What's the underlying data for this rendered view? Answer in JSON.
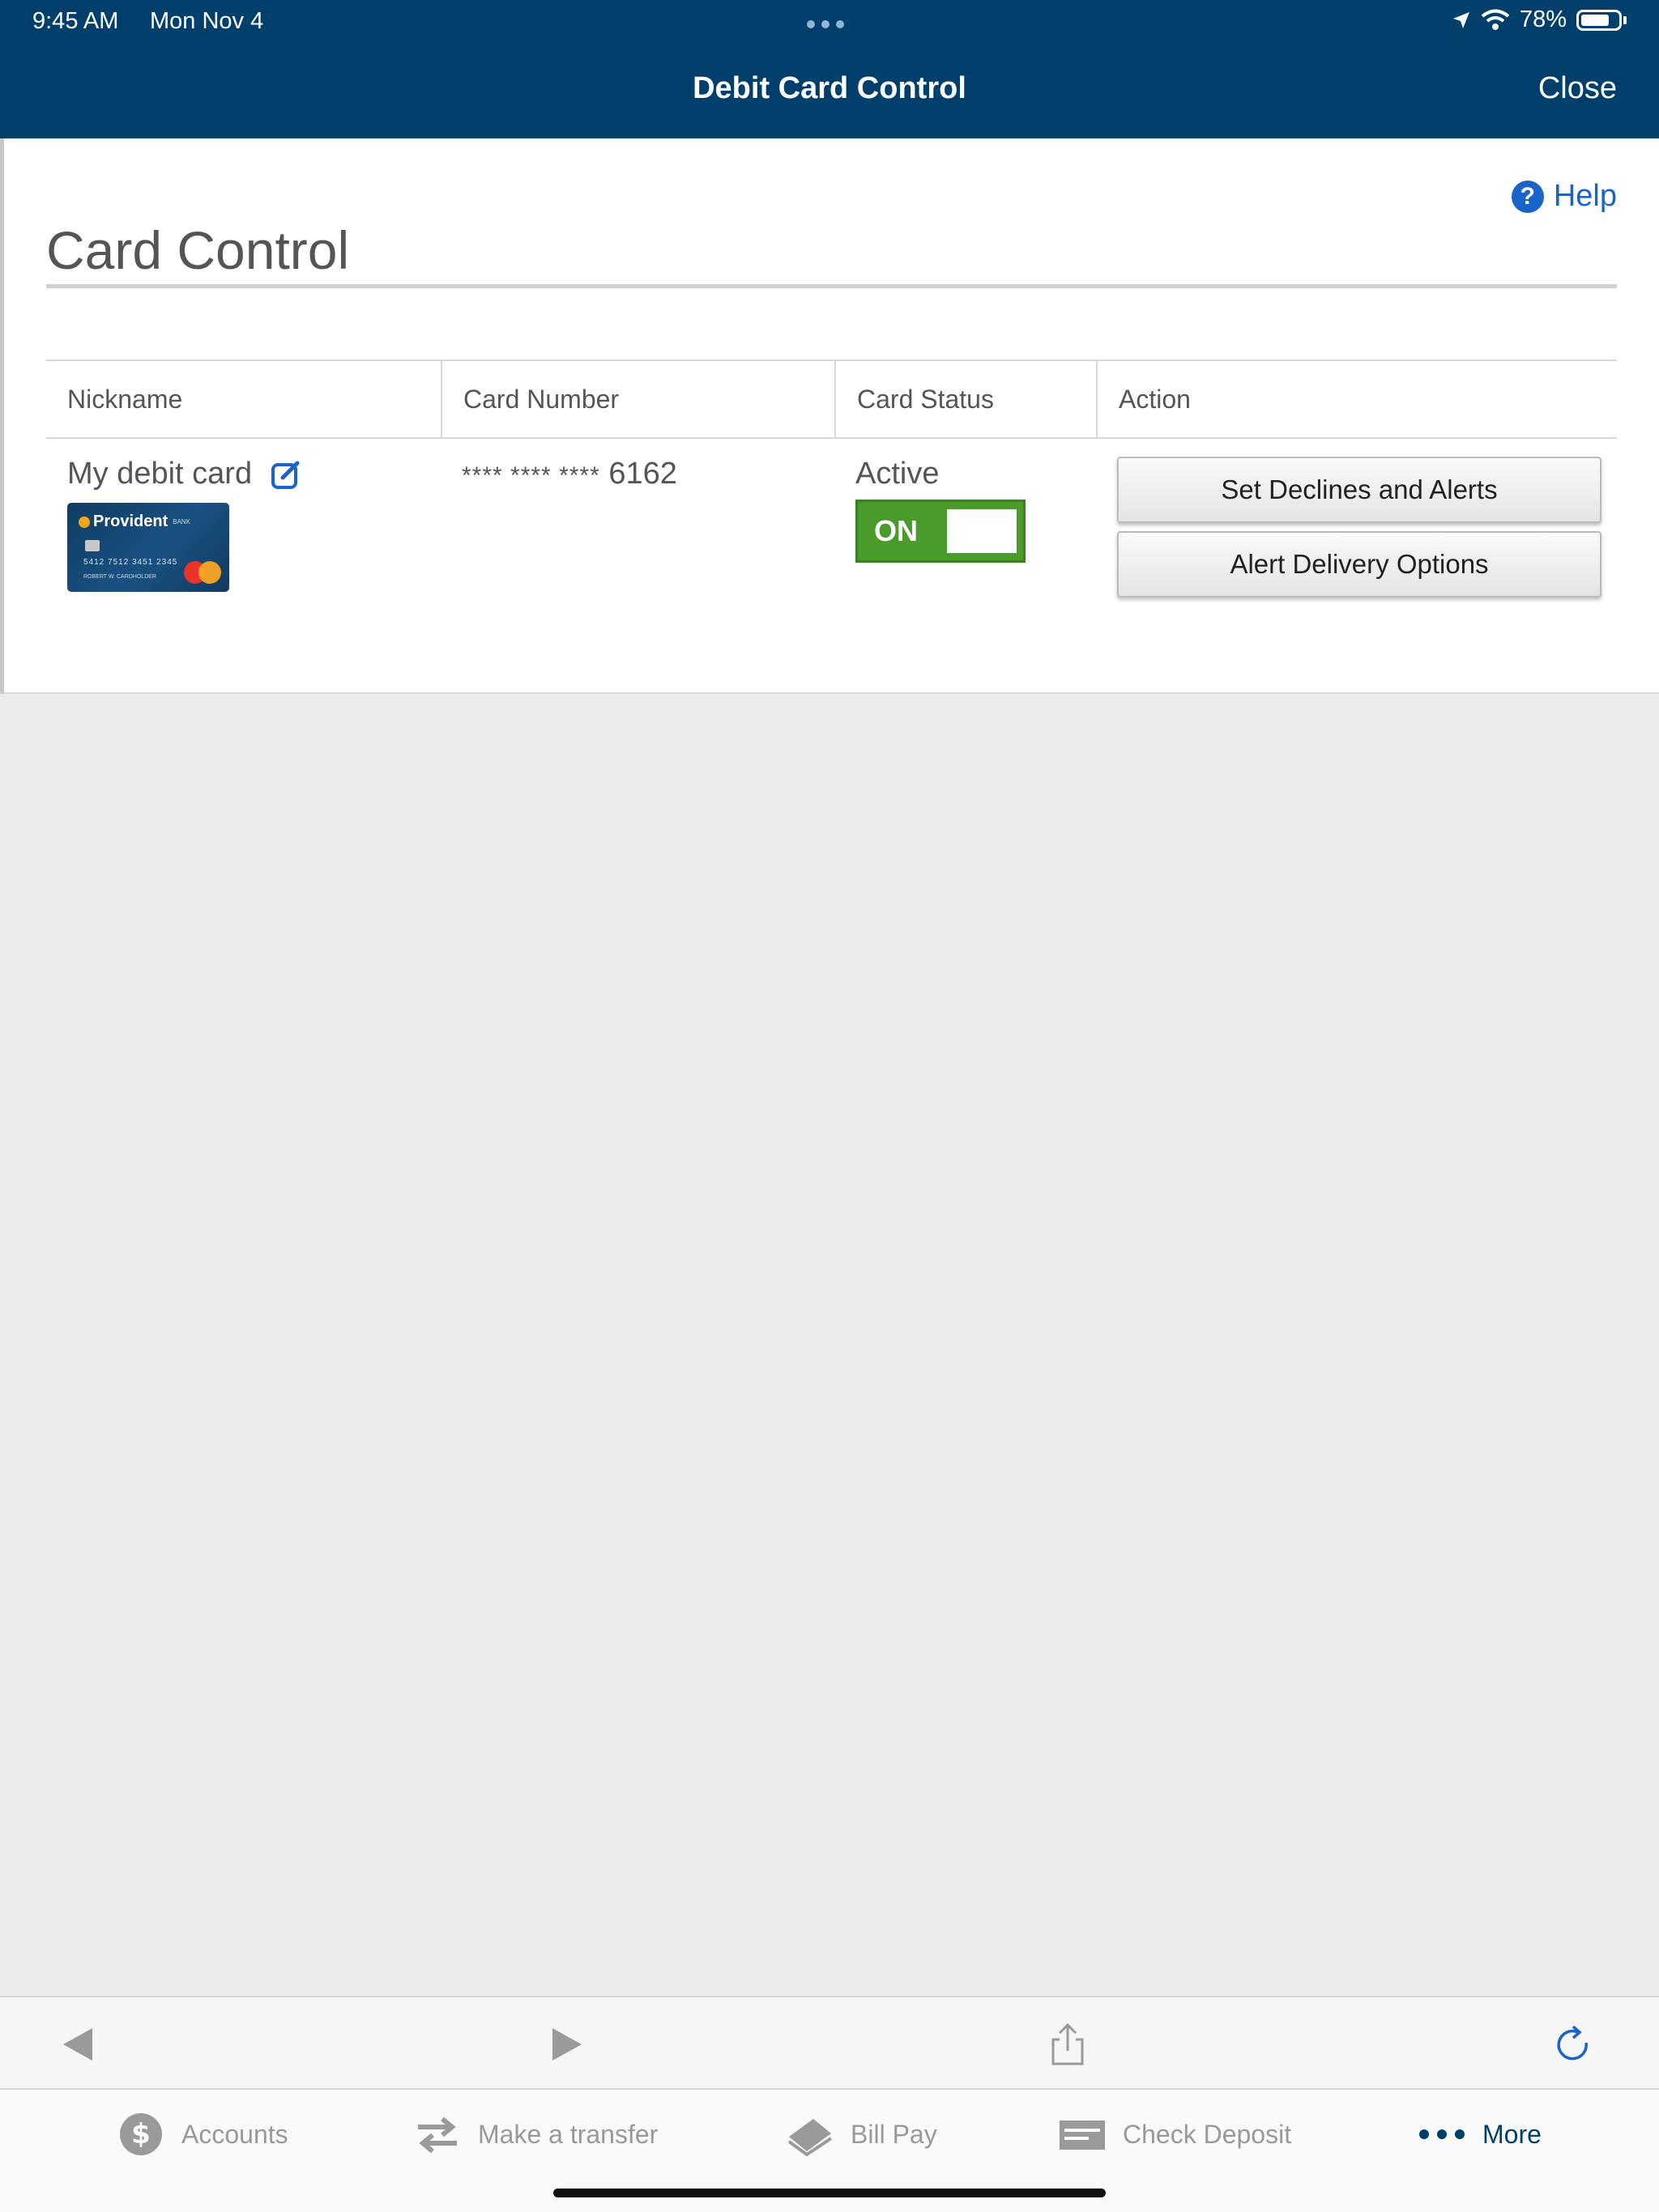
{
  "status_bar": {
    "time": "9:45 AM",
    "date": "Mon Nov 4",
    "battery": "78%"
  },
  "nav": {
    "title": "Debit Card Control",
    "close_label": "Close"
  },
  "page": {
    "help_label": "Help",
    "title": "Card Control"
  },
  "table": {
    "headers": [
      "Nickname",
      "Card Number",
      "Card Status",
      "Action"
    ],
    "row": {
      "nickname": "My debit card",
      "card_stars": "**** **** ****",
      "card_last4": "6162",
      "status": "Active",
      "toggle_label": "ON",
      "actions": [
        "Set Declines and Alerts",
        "Alert Delivery Options"
      ]
    }
  },
  "card_image": {
    "brand": "Provident",
    "bank": "BANK",
    "number": "5412 7512 3451 2345",
    "holder": "ROBERT W. CARDHOLDER"
  },
  "tabs": [
    {
      "label": "Accounts",
      "icon": "dollar-icon"
    },
    {
      "label": "Make a transfer",
      "icon": "transfer-arrows-icon"
    },
    {
      "label": "Bill Pay",
      "icon": "bill-pay-icon"
    },
    {
      "label": "Check Deposit",
      "icon": "check-icon"
    },
    {
      "label": "More",
      "icon": "more-dots-icon"
    }
  ],
  "colors": {
    "nav_bar": "#003f6b",
    "link": "#1a63c8",
    "toggle_on": "#4a9a2c",
    "active_tab": "#003f6b"
  }
}
